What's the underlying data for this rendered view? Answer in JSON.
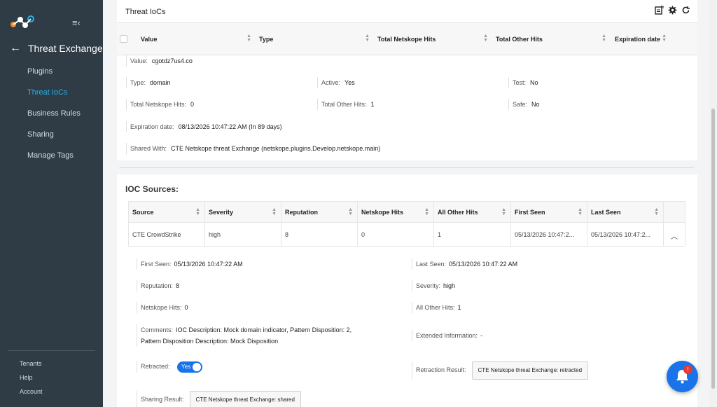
{
  "sidebar": {
    "back_title": "Threat Exchange",
    "items": [
      {
        "label": "Plugins"
      },
      {
        "label": "Threat IoCs"
      },
      {
        "label": "Business Rules"
      },
      {
        "label": "Sharing"
      },
      {
        "label": "Manage Tags"
      }
    ],
    "footer": [
      {
        "label": "Tenants"
      },
      {
        "label": "Help"
      },
      {
        "label": "Account"
      }
    ]
  },
  "panel": {
    "title": "Threat IoCs",
    "columns": [
      "Value",
      "Type",
      "Total Netskope Hits",
      "Total Other Hits",
      "Expiration date"
    ]
  },
  "ioc": {
    "value_label": "Value:",
    "value": "cgotdz7us4.co",
    "type_label": "Type:",
    "type": "domain",
    "active_label": "Active:",
    "active": "Yes",
    "test_label": "Test:",
    "test": "No",
    "netskope_hits_label": "Total Netskope Hits:",
    "netskope_hits": "0",
    "other_hits_label": "Total Other Hits:",
    "other_hits": "1",
    "safe_label": "Safe:",
    "safe": "No",
    "expiration_label": "Expiration date:",
    "expiration": "08/13/2026 10:47:22 AM (In 89 days)",
    "shared_label": "Shared With:",
    "shared": "CTE Netskope threat Exchange (netskope.plugins.Develop.netskope.main)"
  },
  "sources": {
    "title": "IOC Sources:",
    "columns": [
      "Source",
      "Severity",
      "Reputation",
      "Netskope Hits",
      "All Other Hits",
      "First Seen",
      "Last Seen"
    ],
    "row": [
      "CTE CrowdStrike",
      "high",
      "8",
      "0",
      "1",
      "05/13/2026 10:47:2...",
      "05/13/2026 10:47:2..."
    ],
    "detail": {
      "first_seen_label": "First Seen:",
      "first_seen": "05/13/2026 10:47:22 AM",
      "last_seen_label": "Last Seen:",
      "last_seen": "05/13/2026 10:47:22 AM",
      "reputation_label": "Reputation:",
      "reputation": "8",
      "severity_label": "Severity:",
      "severity": "high",
      "netskope_hits_label": "Netskope Hits:",
      "netskope_hits": "0",
      "other_hits_label": "All Other Hits:",
      "other_hits": "1",
      "comments_label": "Comments:",
      "comments_line1": "IOC Description: Mock domain indicator, Pattern Disposition: 2,",
      "comments_line2": "Pattern Disposition Description: Mock Disposition",
      "extended_label": "Extended Information:",
      "extended": "-",
      "retracted_label": "Retracted:",
      "retracted": "Yes",
      "retraction_label": "Retraction Result:",
      "retraction": "CTE Netskope threat Exchange: retracted",
      "sharing_label": "Sharing Result:",
      "sharing": "CTE Netskope threat Exchange: shared"
    }
  },
  "notifications": {
    "badge": "!"
  },
  "colors": {
    "sidebar_bg": "#2f3b45",
    "accent": "#2ab1e6",
    "primary": "#1a73e8"
  }
}
